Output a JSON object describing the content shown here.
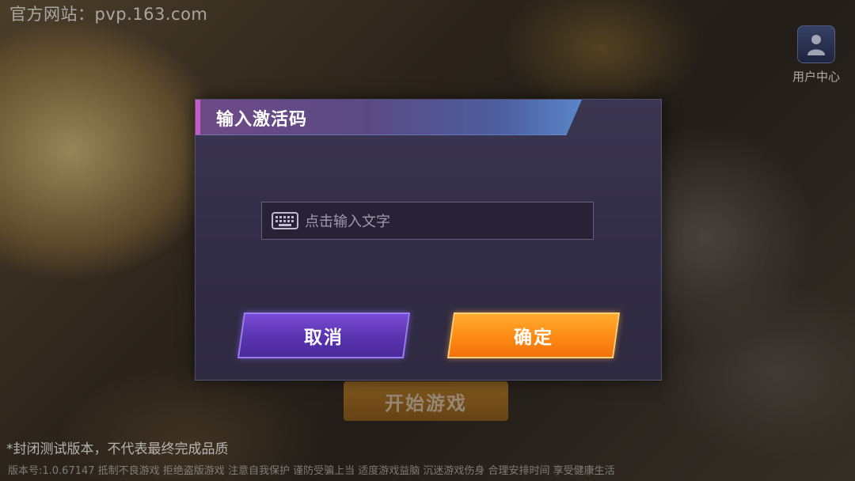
{
  "background": {
    "site_url": "官方网站：pvp.163.com",
    "user_center_label": "用户中心",
    "start_button_label": "开始游戏",
    "disclaimer": "*封闭测试版本，不代表最终完成品质",
    "version_line": "版本号:1.0.67147  抵制不良游戏 拒绝盗版游戏 注意自我保护 谨防受骗上当 适度游戏益脑 沉迷游戏伤身 合理安排时间 享受健康生活"
  },
  "dialog": {
    "title": "输入激活码",
    "input_placeholder": "点击输入文字",
    "input_icon": "keyboard-icon",
    "cancel_label": "取消",
    "confirm_label": "确定"
  },
  "colors": {
    "cancel_button": "#5a33b0",
    "confirm_button": "#ff8a14",
    "dialog_background": "#342f48",
    "header_accent": "#c55cc8"
  }
}
